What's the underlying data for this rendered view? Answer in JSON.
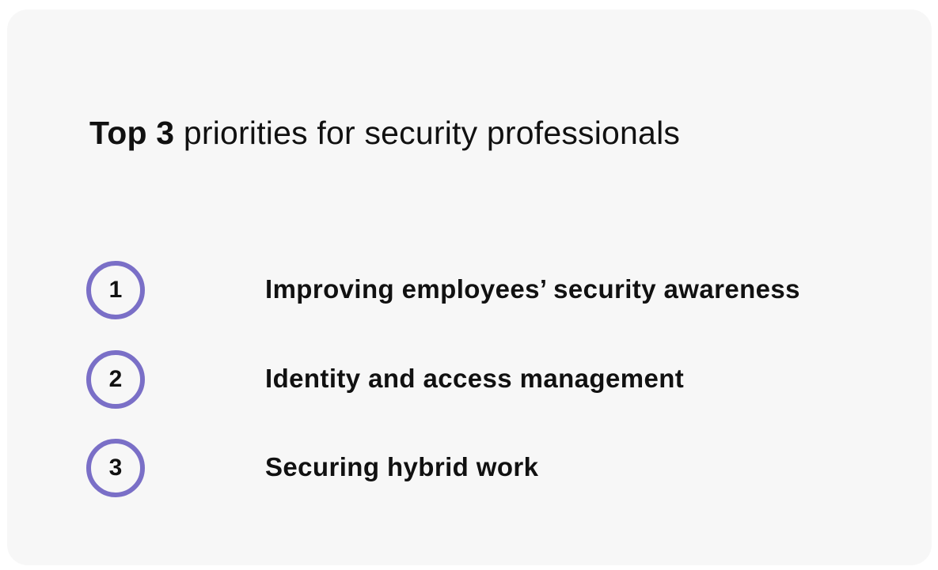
{
  "heading": {
    "bold_part": "Top 3",
    "rest": " priorities for security professionals"
  },
  "priorities": [
    {
      "rank": "1",
      "label": "Improving employees’ security awareness"
    },
    {
      "rank": "2",
      "label": "Identity and access management"
    },
    {
      "rank": "3",
      "label": "Securing hybrid work"
    }
  ],
  "colors": {
    "ring": "#7a6fc7",
    "line_start": "#4c3fa8",
    "line_end": "#9088d6",
    "card_background": "#f7f7f7"
  }
}
